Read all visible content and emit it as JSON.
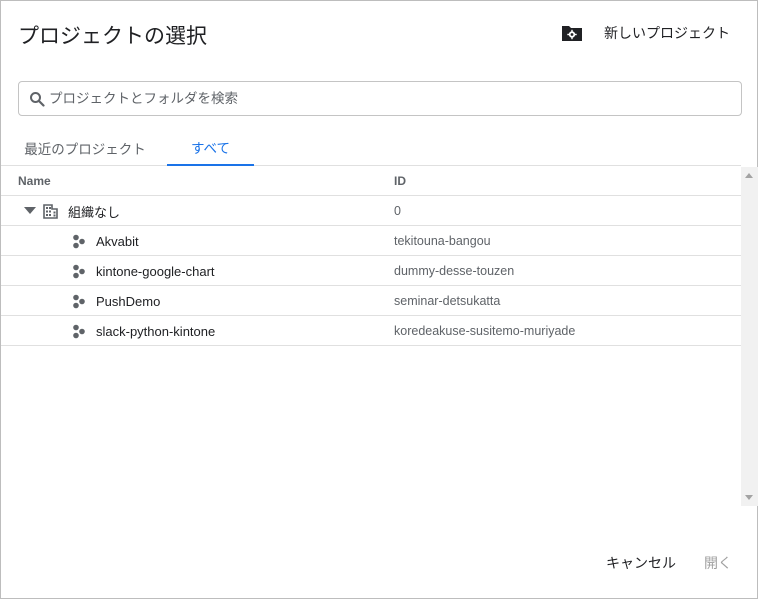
{
  "dialog": {
    "title": "プロジェクトの選択",
    "new_project_label": "新しいプロジェクト"
  },
  "search": {
    "placeholder": "プロジェクトとフォルダを検索"
  },
  "tabs": [
    {
      "label": "最近のプロジェクト",
      "active": false
    },
    {
      "label": "すべて",
      "active": true
    }
  ],
  "table": {
    "headers": {
      "name": "Name",
      "id": "ID"
    },
    "org": {
      "name": "組織なし",
      "id": "0"
    },
    "projects": [
      {
        "name": "Akvabit",
        "id": "tekitouna-bangou"
      },
      {
        "name": "kintone-google-chart",
        "id": "dummy-desse-touzen"
      },
      {
        "name": "PushDemo",
        "id": "seminar-detsukatta"
      },
      {
        "name": "slack-python-kintone",
        "id": "koredeakuse-susitemo-muriyade"
      }
    ]
  },
  "footer": {
    "cancel_label": "キャンセル",
    "open_label": "開く"
  },
  "colors": {
    "accent": "#1a73e8",
    "text": "#202124",
    "muted": "#5f6368",
    "disabled": "#a0a0a0"
  },
  "icons": {
    "new_project": "folder-gear-icon",
    "search": "search-icon",
    "org": "building-icon",
    "project": "project-hexagon-icon",
    "expand": "caret-down-icon"
  }
}
